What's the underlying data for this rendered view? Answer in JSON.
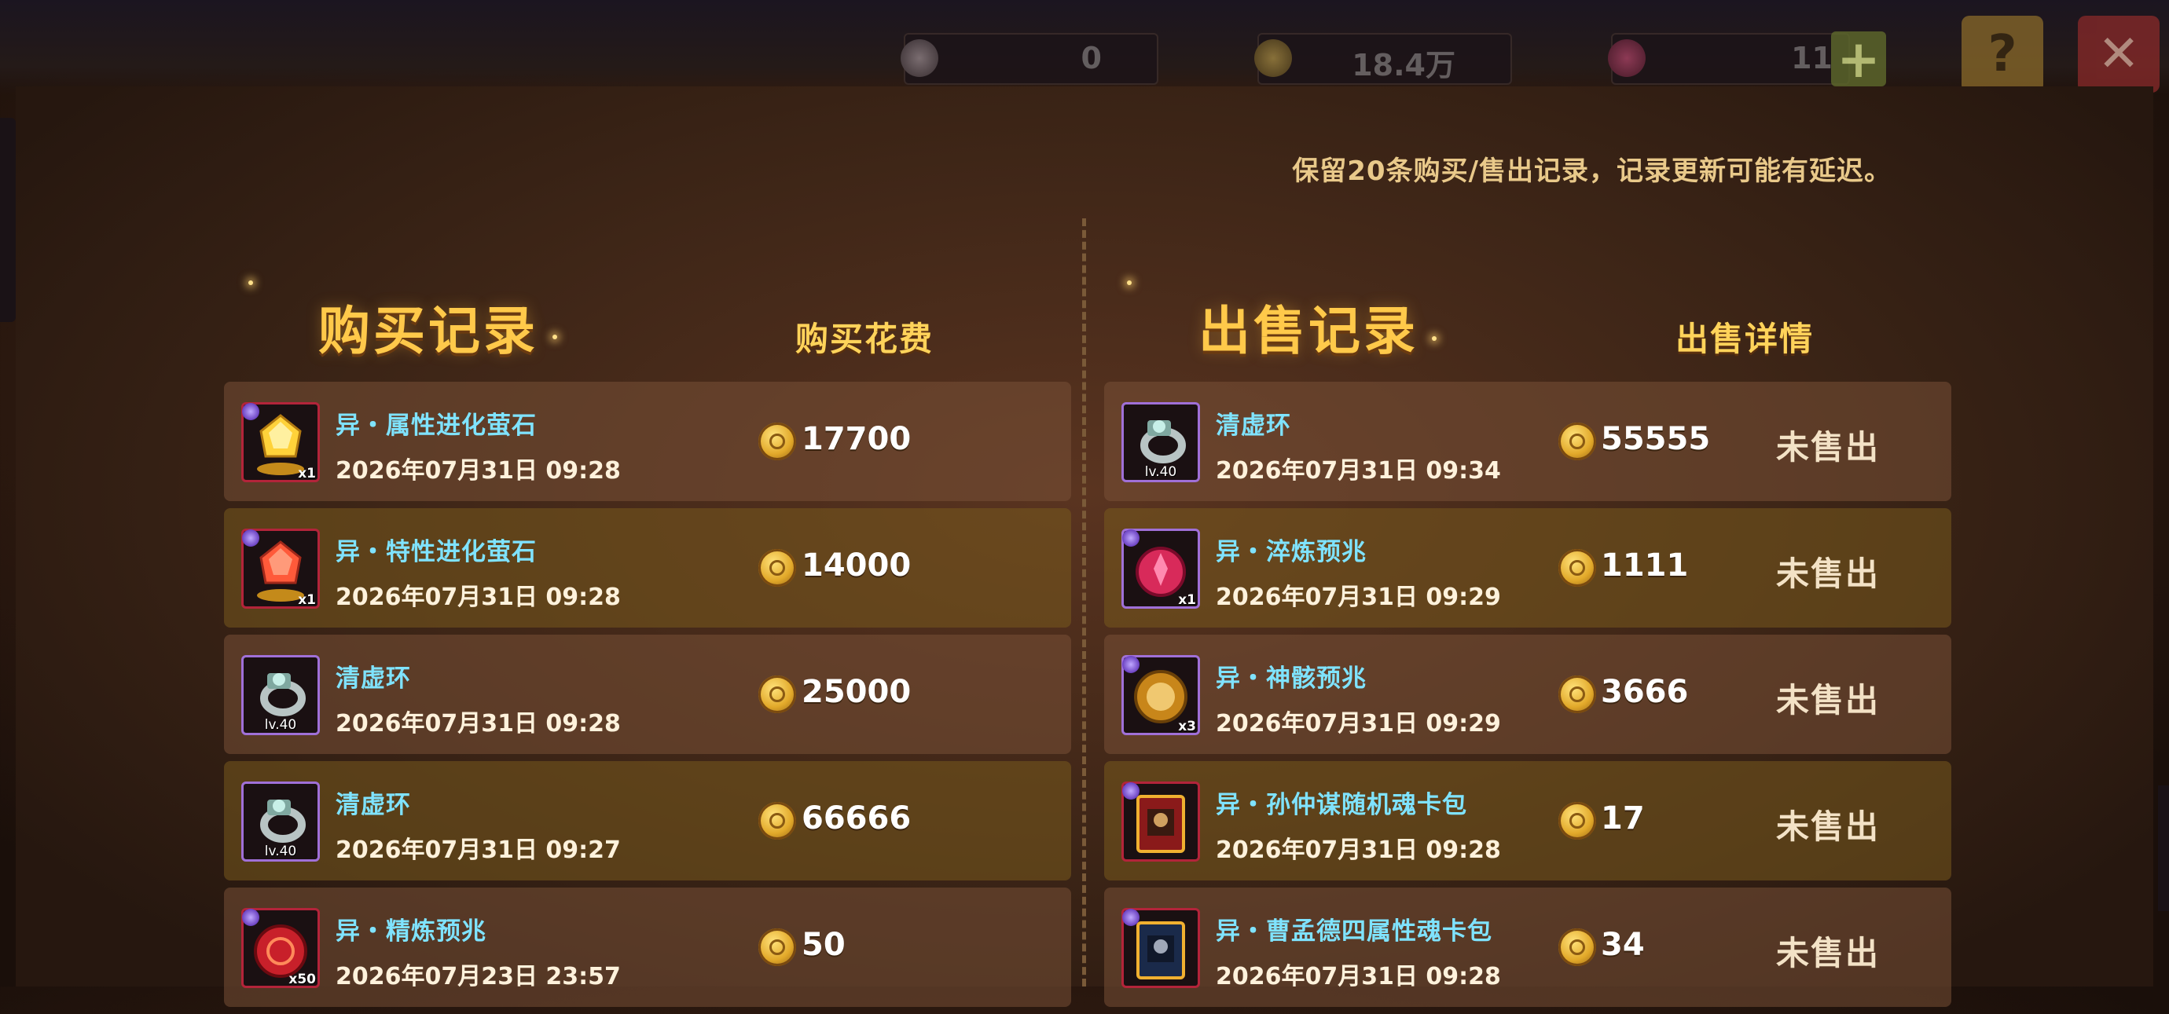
{
  "currency": [
    {
      "icon": "crystal-icon",
      "value": "0"
    },
    {
      "icon": "gold-coin-icon",
      "value": "18.4万"
    },
    {
      "icon": "gem-icon",
      "value": "11"
    }
  ],
  "top_buttons": {
    "plus": "+",
    "help": "?",
    "close": "✕"
  },
  "note": "保留20条购买/售出记录，记录更新可能有延迟。",
  "buy": {
    "title": "购买记录",
    "column": "购买花费",
    "rows": [
      {
        "name": "异・属性进化萤石",
        "time": "2026年07月31日 09:28",
        "price": "17700",
        "badge": "x1",
        "icon": "yellow-gem-icon"
      },
      {
        "name": "异・特性进化萤石",
        "time": "2026年07月31日 09:28",
        "price": "14000",
        "badge": "x1",
        "icon": "red-gem-icon"
      },
      {
        "name": "清虚环",
        "time": "2026年07月31日 09:28",
        "price": "25000",
        "badge": "lv.40",
        "icon": "ring-icon"
      },
      {
        "name": "清虚环",
        "time": "2026年07月31日 09:27",
        "price": "66666",
        "badge": "lv.40",
        "icon": "ring-icon"
      },
      {
        "name": "异・精炼预兆",
        "time": "2026年07月23日 23:57",
        "price": "50",
        "badge": "x50",
        "icon": "red-omen-icon"
      }
    ]
  },
  "sell": {
    "title": "出售记录",
    "column": "出售详情",
    "rows": [
      {
        "name": "清虚环",
        "time": "2026年07月31日 09:34",
        "price": "55555",
        "status": "未售出",
        "badge": "lv.40",
        "icon": "ring-icon"
      },
      {
        "name": "异・淬炼预兆",
        "time": "2026年07月31日 09:29",
        "price": "1111",
        "status": "未售出",
        "badge": "x1",
        "icon": "red-omen-icon"
      },
      {
        "name": "异・神骸预兆",
        "time": "2026年07月31日 09:29",
        "price": "3666",
        "status": "未售出",
        "badge": "x3",
        "icon": "gold-omen-icon"
      },
      {
        "name": "异・孙仲谋随机魂卡包",
        "time": "2026年07月31日 09:28",
        "price": "17",
        "status": "未售出",
        "badge": "",
        "icon": "card-pack-icon"
      },
      {
        "name": "异・曹孟德四属性魂卡包",
        "time": "2026年07月31日 09:28",
        "price": "34",
        "status": "未售出",
        "badge": "",
        "icon": "card-pack-icon"
      }
    ]
  }
}
